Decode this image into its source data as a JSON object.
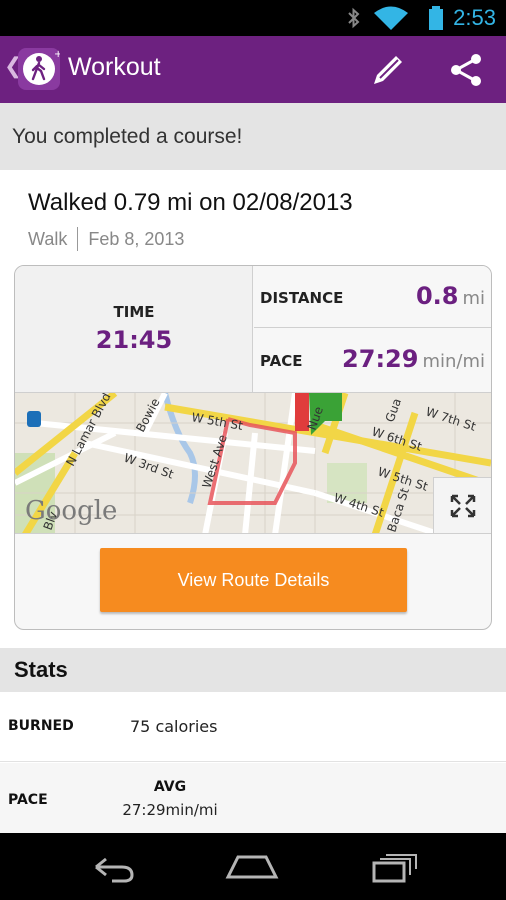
{
  "status_bar": {
    "time": "2:53",
    "icons": [
      "bluetooth-icon",
      "wifi-icon",
      "battery-icon"
    ]
  },
  "action_bar": {
    "title": "Workout",
    "actions": [
      "edit-icon",
      "share-icon"
    ]
  },
  "banner": {
    "text": "You completed a course!"
  },
  "workout": {
    "headline": "Walked 0.79 mi on 02/08/2013",
    "type": "Walk",
    "date": "Feb 8, 2013"
  },
  "summary": {
    "time_label": "TIME",
    "time_value": "21:45",
    "distance_label": "DISTANCE",
    "distance_value": "0.8",
    "distance_unit": "mi",
    "pace_label": "PACE",
    "pace_value": "27:29",
    "pace_unit": "min/mi"
  },
  "map": {
    "logo": "Google",
    "streets": [
      "N Lamar Blvd",
      "Bowie",
      "W 5th St",
      "W 3rd St",
      "West Ave",
      "W 6th St",
      "W 7th St",
      "W 5th St",
      "W 4th St",
      "Nue",
      "Gua",
      "Baca St",
      "Blv"
    ],
    "route_color": "#e8555b",
    "start_flag_color": "#3aa236",
    "end_flag_color": "#e03c3c"
  },
  "route_button": {
    "label": "View Route Details"
  },
  "stats": {
    "header": "Stats",
    "burned_label": "BURNED",
    "burned_value": "75 calories",
    "pace_label": "PACE",
    "avg_label": "AVG",
    "avg_value": "27:29min/mi"
  },
  "colors": {
    "brand": "#6d2180",
    "accent": "#f68b1f",
    "value": "#6b2080"
  }
}
